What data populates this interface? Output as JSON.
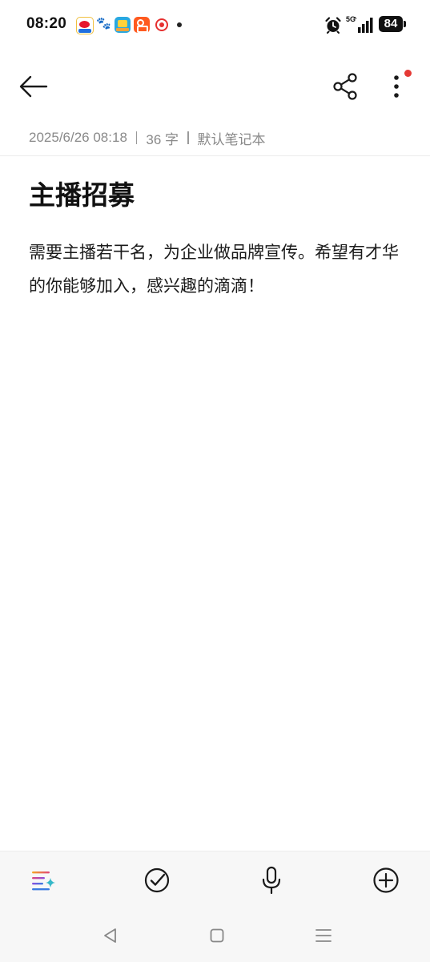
{
  "status_bar": {
    "time": "08:20",
    "network": "5G",
    "battery": "84",
    "notification_icons": [
      "weibo-icon",
      "baidu-icon",
      "app-icon",
      "kuaishou-icon",
      "app-icon"
    ]
  },
  "app_bar": {
    "back_icon": "arrow-left-icon",
    "share_icon": "share-icon",
    "more_icon": "more-vertical-icon",
    "badge_color": "#e53935"
  },
  "note": {
    "meta": {
      "date": "2025/6/26 08:18",
      "word_count": "36 字",
      "notebook": "默认笔记本"
    },
    "title": "主播招募",
    "body": "需要主播若干名，为企业做品牌宣传。希望有才华的你能够加入，感兴趣的滴滴！"
  },
  "toolbar": {
    "items": [
      "ai-format-icon",
      "checklist-icon",
      "microphone-icon",
      "add-circle-icon"
    ]
  },
  "system_nav": {
    "items": [
      "nav-back-icon",
      "nav-home-icon",
      "nav-recents-icon"
    ]
  }
}
